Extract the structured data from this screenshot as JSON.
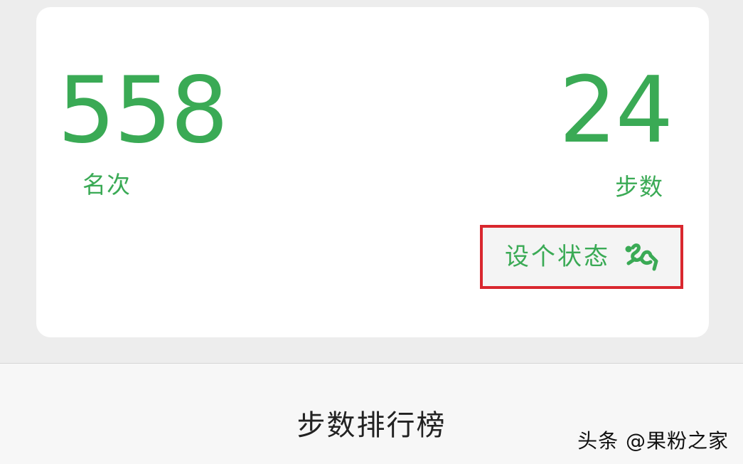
{
  "card": {
    "rank_value": "558",
    "rank_label": "名次",
    "steps_value": "24",
    "steps_label": "步数",
    "status_button": {
      "label": "设个状态",
      "icon": "running-person-icon",
      "highlight_color": "#d9272e"
    }
  },
  "leaderboard": {
    "title": "步数排行榜"
  },
  "watermark": "头条 @果粉之家",
  "colors": {
    "accent": "#3aaa55",
    "background": "#ededed",
    "card": "#ffffff"
  }
}
